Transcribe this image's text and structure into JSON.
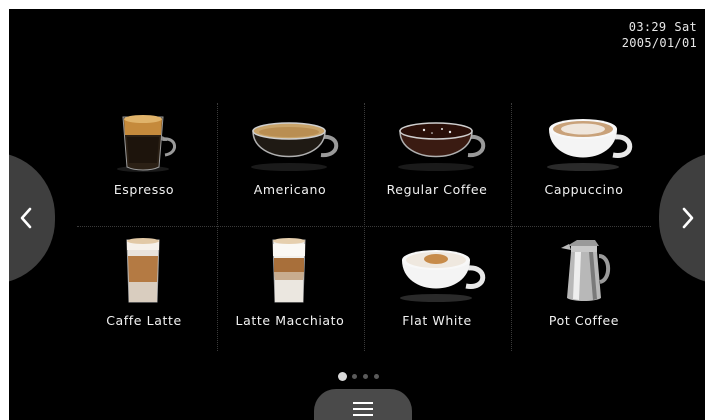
{
  "status": {
    "time": "03:29",
    "day": "Sat",
    "date": "2005/01/01"
  },
  "drinks": [
    {
      "label": "Espresso",
      "icon": "espresso-glass-icon"
    },
    {
      "label": "Americano",
      "icon": "americano-cup-icon"
    },
    {
      "label": "Regular Coffee",
      "icon": "regular-coffee-cup-icon"
    },
    {
      "label": "Cappuccino",
      "icon": "cappuccino-cup-icon"
    },
    {
      "label": "Caffe Latte",
      "icon": "caffe-latte-glass-icon"
    },
    {
      "label": "Latte Macchiato",
      "icon": "latte-macchiato-glass-icon"
    },
    {
      "label": "Flat White",
      "icon": "flat-white-cup-icon"
    },
    {
      "label": "Pot Coffee",
      "icon": "coffee-pot-icon"
    }
  ],
  "pagination": {
    "pages": 4,
    "current": 1
  },
  "navigation": {
    "prev_icon": "chevron-left-icon",
    "next_icon": "chevron-right-icon",
    "menu_icon": "hamburger-menu-icon"
  },
  "colors": {
    "background": "#000000",
    "nav_button": "#3f3f3f",
    "menu_tab": "#4a4a4a",
    "text": "#f2f2f2",
    "active_dot": "#d9d9d9"
  }
}
